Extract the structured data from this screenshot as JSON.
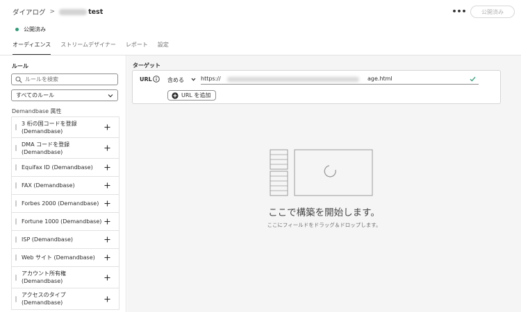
{
  "header": {
    "breadcrumb_root": "ダイアログ",
    "breadcrumb_separator": ">",
    "breadcrumb_current": "test",
    "more_label": "•••",
    "publish_label": "公開済み",
    "status_text": "公開済み",
    "status_color": "#2d9d78"
  },
  "tabs": [
    {
      "label": "オーディエンス",
      "active": true
    },
    {
      "label": "ストリームデザイナー",
      "active": false
    },
    {
      "label": "レポート",
      "active": false
    },
    {
      "label": "設定",
      "active": false
    }
  ],
  "sidebar": {
    "title": "ルール",
    "search_placeholder": "ルールを検索",
    "filter_value": "すべてのルール",
    "group_title": "Demandbase 属性",
    "items": [
      {
        "label": "3 桁の国コードを登録 (Demandbase)"
      },
      {
        "label": "DMA コードを登録 (Demandbase)"
      },
      {
        "label": "Equifax ID (Demandbase)"
      },
      {
        "label": "FAX (Demandbase)"
      },
      {
        "label": "Forbes 2000 (Demandbase)"
      },
      {
        "label": "Fortune 1000 (Demandbase)"
      },
      {
        "label": "ISP (Demandbase)"
      },
      {
        "label": "Web サイト (Demandbase)"
      },
      {
        "label": "アカウント所有権 (Demandbase)"
      },
      {
        "label": "アクセスのタイプ (Demandbase)"
      }
    ]
  },
  "target": {
    "title": "ターゲット",
    "url_label": "URL",
    "operator": "含める",
    "url_prefix": "https://",
    "url_suffix": "age.html",
    "add_url_label": "URL を追加"
  },
  "empty_state": {
    "title": "ここで構築を開始します。",
    "subtitle": "ここにフィールドをドラッグ＆ドロップします。"
  },
  "colors": {
    "accent_green": "#2d9d78",
    "border": "#e1e1e1",
    "canvas_bg": "#f5f5f5"
  }
}
